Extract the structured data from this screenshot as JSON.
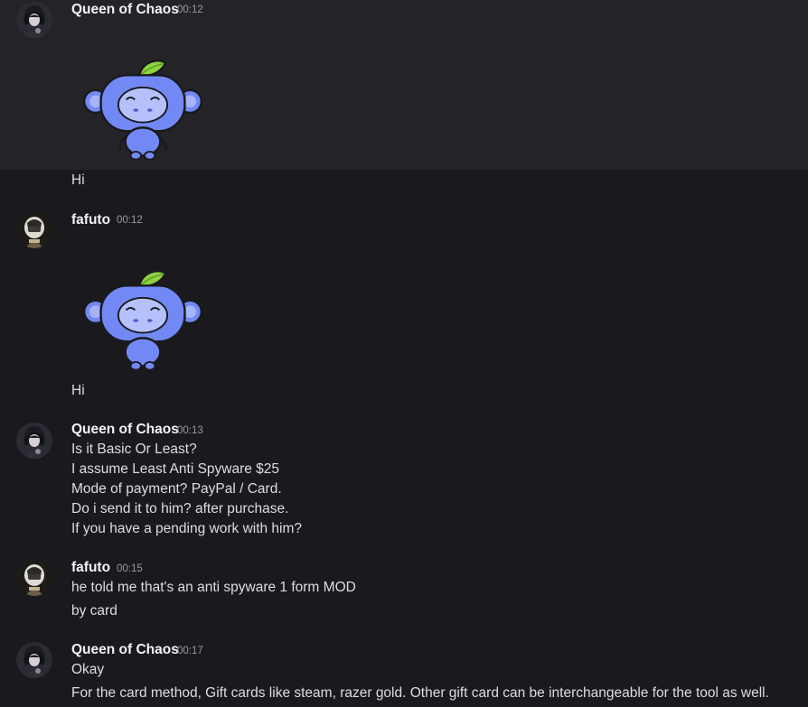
{
  "messages": [
    {
      "author": "Queen of Chaos",
      "time": "00:12",
      "lines": [
        "Hi"
      ]
    },
    {
      "author": "fafuto",
      "time": "00:12",
      "lines": [
        "Hi"
      ]
    },
    {
      "author": "Queen of Chaos",
      "time": "00:13",
      "lines": [
        "Is it Basic Or Least?",
        "I assume Least Anti Spyware $25",
        "Mode of payment? PayPal / Card.",
        "Do i send it to him? after purchase.",
        "If you have a pending work with him?"
      ]
    },
    {
      "author": "fafuto",
      "time": "00:15",
      "lines": [
        "he told me that's an anti spyware 1 form MOD",
        "by card"
      ]
    },
    {
      "author": "Queen of Chaos",
      "time": "00:17",
      "lines": [
        "Okay",
        "For the card method, Gift cards like steam, razer gold. Other gift card can be interchangeable for the tool as well."
      ]
    }
  ],
  "colors": {
    "background": "#1a1a1e",
    "hover_background": "#242428",
    "sticker_blue": "#7289f5",
    "leaf_green": "#8ed243"
  }
}
